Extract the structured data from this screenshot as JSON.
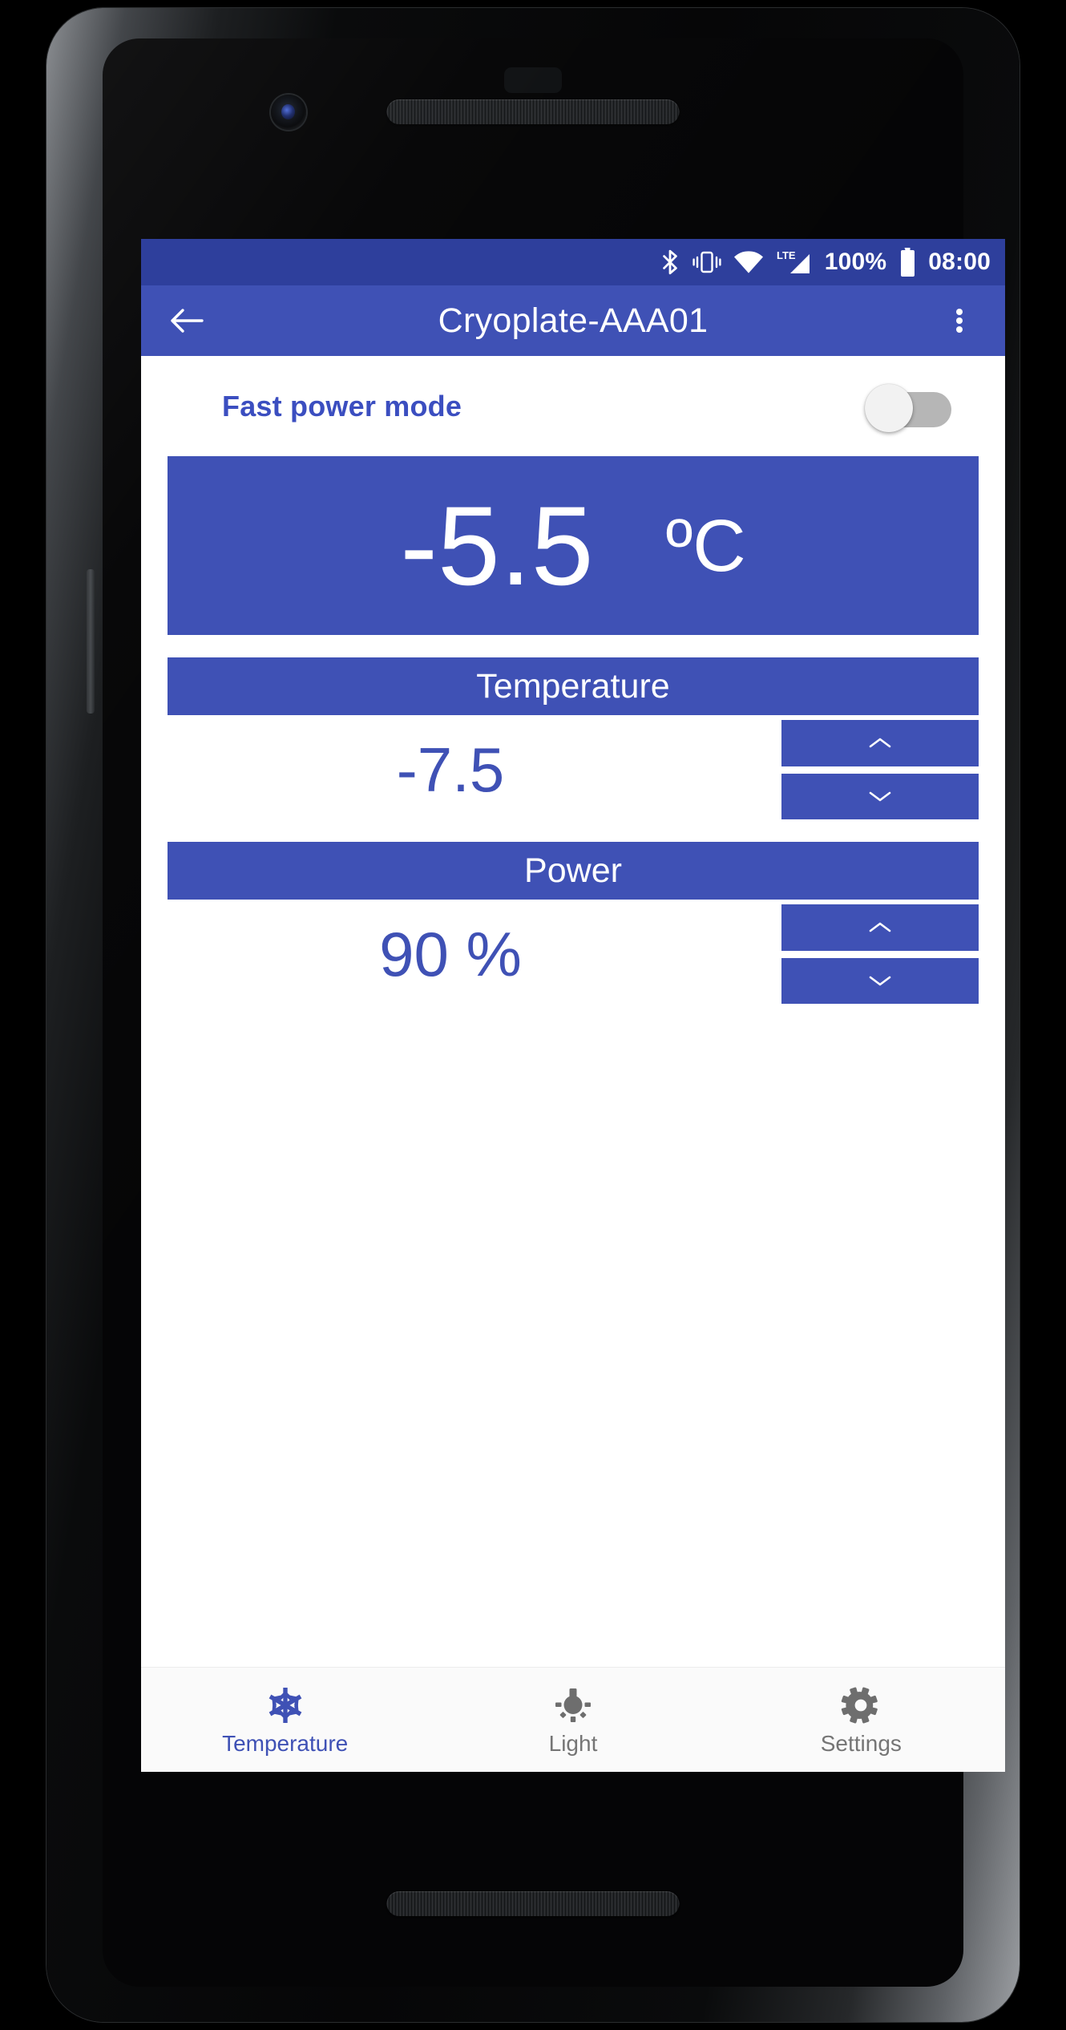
{
  "status_bar": {
    "bluetooth_icon": "bluetooth-icon",
    "vibrate_icon": "vibrate-icon",
    "wifi_icon": "wifi-icon",
    "signal_icon": "lte-signal-icon",
    "network_type": "LTE",
    "battery_percent": "100%",
    "battery_icon": "battery-full-icon",
    "clock": "08:00"
  },
  "app_bar": {
    "back_icon": "arrow-left-icon",
    "title": "Cryoplate-AAA01",
    "overflow_icon": "more-vertical-icon"
  },
  "fast_power_mode": {
    "label": "Fast power mode",
    "state": "off"
  },
  "readout": {
    "value": "-5.5",
    "unit": "ºC"
  },
  "temperature": {
    "header": "Temperature",
    "value": "-7.5",
    "increase_icon": "chevron-up-icon",
    "decrease_icon": "chevron-down-icon"
  },
  "power": {
    "header": "Power",
    "value": "90 %",
    "increase_icon": "chevron-up-icon",
    "decrease_icon": "chevron-down-icon"
  },
  "bottom_nav": {
    "items": [
      {
        "label": "Temperature",
        "icon": "snowflake-icon",
        "active": true
      },
      {
        "label": "Light",
        "icon": "lightbulb-icon",
        "active": false
      },
      {
        "label": "Settings",
        "icon": "gear-icon",
        "active": false
      }
    ]
  },
  "colors": {
    "primary": "#3f51b5",
    "primary_dark": "#2e3f9c",
    "accent_text": "#3b4ec0",
    "inactive": "#757575",
    "surface": "#ffffff",
    "nav_surface": "#fafafa"
  }
}
